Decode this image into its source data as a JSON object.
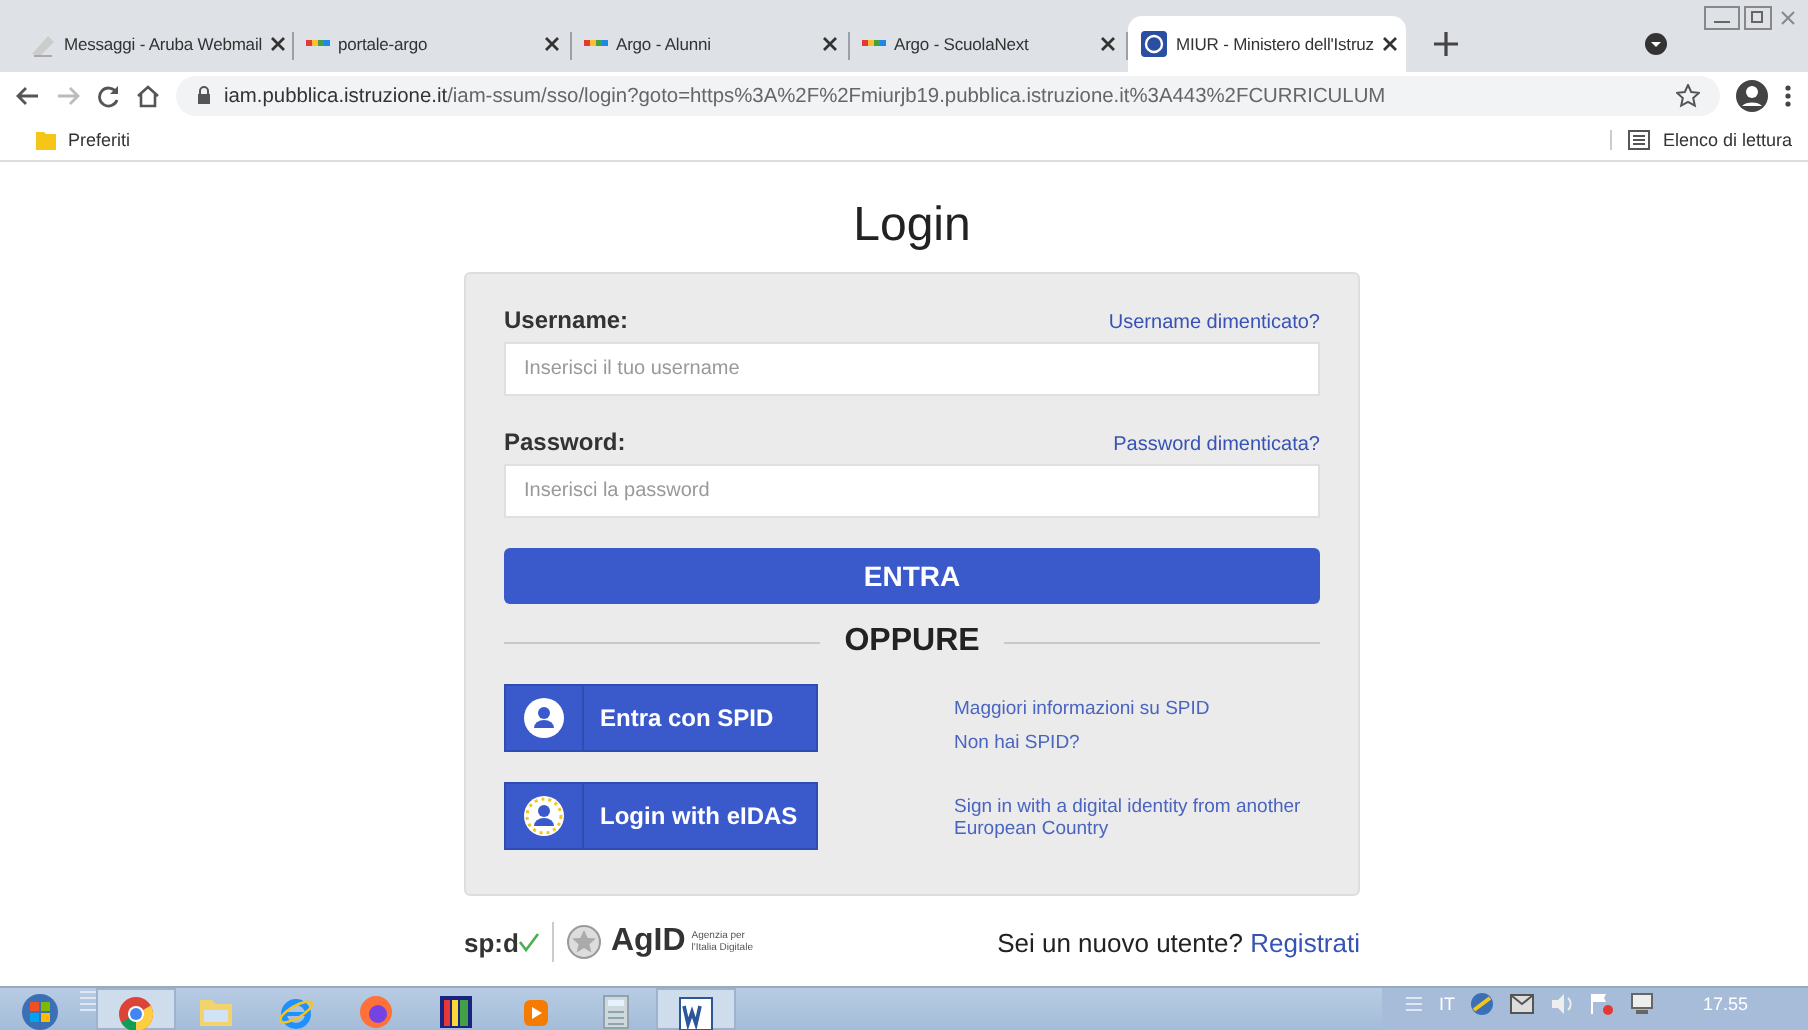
{
  "browser": {
    "tabs": [
      {
        "kind": "mail",
        "title": "Messaggi - Aruba Webmail",
        "selected": false
      },
      {
        "kind": "argo",
        "title": "portale-argo",
        "selected": false
      },
      {
        "kind": "argo",
        "title": "Argo - Alunni",
        "selected": false
      },
      {
        "kind": "argo",
        "title": "Argo - ScuolaNext",
        "selected": false
      },
      {
        "kind": "miur",
        "title": "MIUR - Ministero dell'Istruz",
        "selected": true
      }
    ],
    "address": {
      "host": "iam.pubblica.istruzione.it",
      "path": "/iam-ssum/sso/login?goto=https%3A%2F%2Fmiurjb19.pubblica.istruzione.it%3A443%2FCURRICULUM"
    },
    "bookmarks": [
      "Preferiti"
    ],
    "reading_list": "Elenco di lettura"
  },
  "login": {
    "title": "Login",
    "fields": [
      {
        "label": "Username:",
        "link": "Username dimenticato?",
        "placeholder": "Inserisci il tuo username"
      },
      {
        "label": "Password:",
        "link": "Password dimenticata?",
        "placeholder": "Inserisci la password"
      }
    ],
    "submit": "ENTRA",
    "divider": "OPPURE",
    "providers": [
      {
        "kind": "spid",
        "label": "Entra con SPID",
        "links": [
          "Maggiori informazioni su SPID",
          "Non hai SPID?"
        ]
      },
      {
        "kind": "eidas",
        "label": "Login with eIDAS",
        "links": [
          "Sign in with a digital identity from another European Country"
        ]
      }
    ]
  },
  "footer": {
    "spid_logo": "sp:d",
    "agid_logo": "AgID",
    "agid_caption": "Agenzia per l'Italia Digitale",
    "signup_prompt": "Sei un nuovo utente?",
    "signup_link": "Registrati"
  },
  "taskbar": {
    "apps": [
      {
        "kind": "start",
        "selected": false
      },
      {
        "kind": "chrome",
        "selected": true
      },
      {
        "kind": "folder",
        "selected": false
      },
      {
        "kind": "ie",
        "selected": false
      },
      {
        "kind": "firefox",
        "selected": false
      },
      {
        "kind": "paint",
        "selected": false
      },
      {
        "kind": "media",
        "selected": false
      },
      {
        "kind": "calculator",
        "selected": false
      },
      {
        "kind": "word",
        "selected": true
      }
    ],
    "language": "IT",
    "clock": "17.55"
  }
}
